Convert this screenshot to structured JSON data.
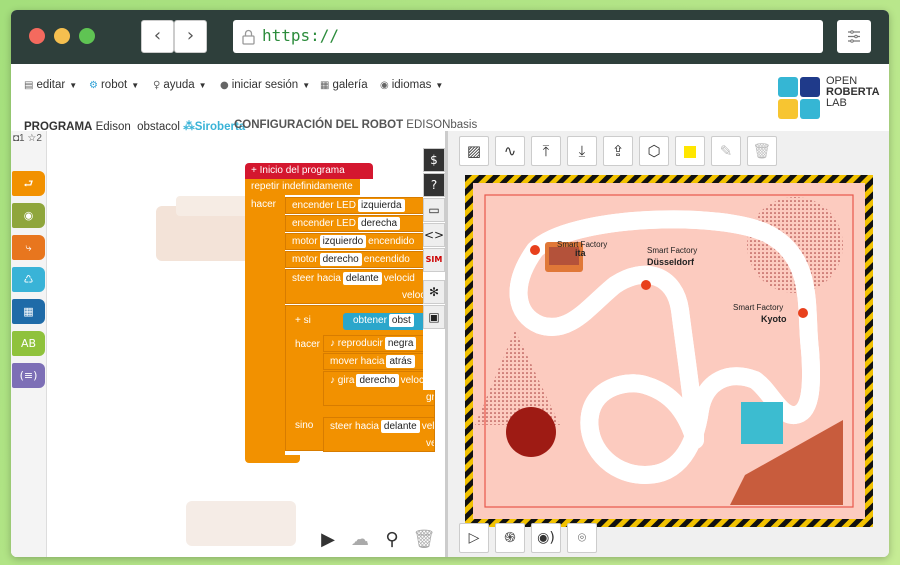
{
  "browser": {
    "url": "https://"
  },
  "menu": {
    "items": [
      {
        "label": "editar",
        "icon": "edit-icon"
      },
      {
        "label": "robot",
        "icon": "robot-icon"
      },
      {
        "label": "ayuda",
        "icon": "lightbulb-icon"
      },
      {
        "label": "iniciar sesión",
        "icon": "user-icon"
      },
      {
        "label": "galería",
        "icon": "gallery-icon"
      },
      {
        "label": "idiomas",
        "icon": "globe-icon"
      }
    ]
  },
  "tabs": {
    "program_label": "PROGRAMA",
    "program_name": "Edison_obstacol",
    "program_tag": "Siroberta",
    "config_label": "CONFIGURACIÓN DEL ROBOT",
    "config_name": "EDISONbasis"
  },
  "logo": {
    "line1": "OPEN",
    "line2": "ROBERTA",
    "line3": "LAB"
  },
  "toolbox": {
    "counter1": "1",
    "counter2": "2"
  },
  "blocks": {
    "start": "Inicio del programa",
    "repeat": "repetir indefinidamente",
    "do": "hacer",
    "led1": "encender LED",
    "led1_opt": "izquierda",
    "led2": "encender LED",
    "led2_opt": "derecha",
    "motor1": "motor",
    "motor1_opt": "izquierdo",
    "motor1_tail": "encendido",
    "motor2": "motor",
    "motor2_opt": "derecho",
    "motor2_tail": "encendido",
    "steer": "steer",
    "steer_hacia": "hacia",
    "steer_opt": "delante",
    "steer_vel": "velocid",
    "steer_vel2": "veloci",
    "if": "si",
    "get": "obtener",
    "get_opt": "obst",
    "then": "hacer",
    "play": "reproducir",
    "play_opt": "negra",
    "move": "mover",
    "move_hacia": "hacia",
    "move_opt": "atrás",
    "turn": "gira",
    "turn_opt": "derecho",
    "turn_vel": "velocid",
    "turn_tail": "gra",
    "else": "sino",
    "steer2": "steer",
    "steer2_hacia": "hacia",
    "steer2_opt": "delante",
    "steer2_vel": "vel",
    "steer2_tail": "ve"
  },
  "sidebar": {
    "sim_label": "SIM"
  },
  "sim": {
    "labels": [
      {
        "top": "Smart Factory",
        "bottom": "ita"
      },
      {
        "top": "Smart Factory",
        "bottom": "Düsseldorf"
      },
      {
        "top": "Smart Factory",
        "bottom": "Kyoto"
      }
    ]
  }
}
